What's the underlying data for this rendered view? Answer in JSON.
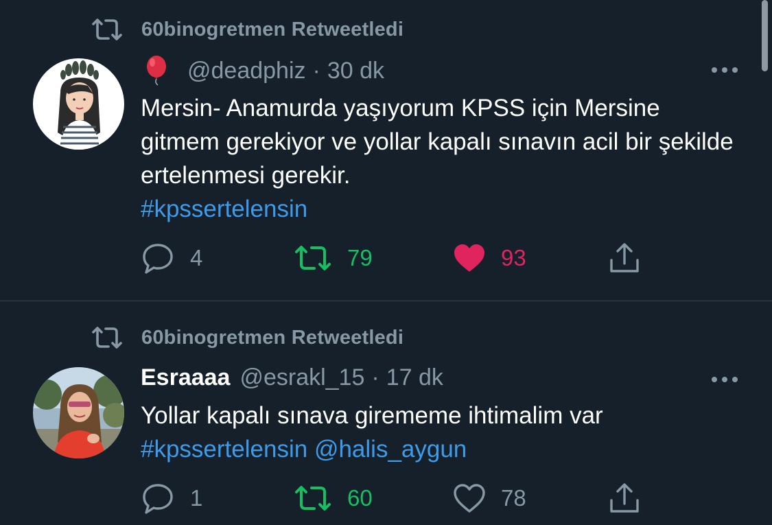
{
  "tweets": [
    {
      "retweeted_by": "60binogretmen Retweetledi",
      "display_name": "",
      "name_emoji": "balloon-icon",
      "handle": "@deadphiz",
      "separator": "·",
      "time": "30 dk",
      "text": "Mersin- Anamurda yaşıyorum KPSS için Mersine gitmem gerekiyor ve yollar kapalı sınavın acil bir şekilde ertelenmesi gerekir.",
      "hashtag": "#kpssertelensin",
      "mention": "",
      "replies": "4",
      "retweets": "79",
      "likes": "93",
      "liked": true
    },
    {
      "retweeted_by": "60binogretmen Retweetledi",
      "display_name": "Esraaaa",
      "handle": "@esrakl_15",
      "separator": "·",
      "time": "17 dk",
      "text": "Yollar kapalı sınava girememe ihtimalim var",
      "hashtag": "#kpssertelensin",
      "mention": "@halis_aygun",
      "replies": "1",
      "retweets": "60",
      "likes": "78",
      "liked": false
    }
  ],
  "colors": {
    "background": "#15202b",
    "secondary_text": "#8899a6",
    "link": "#3e9bea",
    "retweet_green": "#17bf63",
    "like_red": "#e0245e"
  }
}
